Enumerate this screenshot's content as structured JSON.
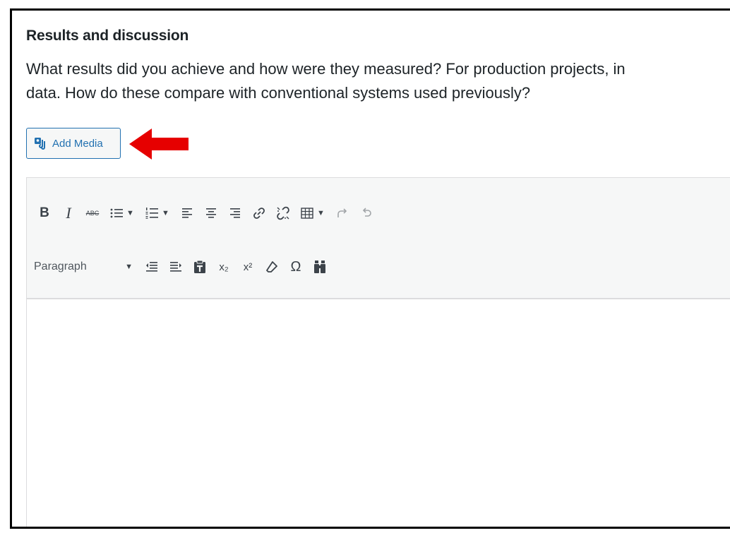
{
  "section": {
    "title": "Results and discussion",
    "desc_line1": "What results did you achieve and how were they measured? For production projects, in",
    "desc_line2": "data. How do these compare with conventional systems used previously?"
  },
  "media": {
    "add_label": "Add Media"
  },
  "toolbar": {
    "row1": [
      "bold-icon",
      "italic-icon",
      "strikethrough-icon",
      "bullet-list-icon",
      "numbered-list-icon",
      "align-left-icon",
      "align-center-icon",
      "align-right-icon",
      "link-icon",
      "unlink-icon",
      "table-icon",
      "redo-icon",
      "undo-icon"
    ],
    "bold_glyph": "B",
    "italic_glyph": "I",
    "strike_glyph": "ABC",
    "subscript_glyph": "x₂",
    "superscript_glyph": "x²",
    "omega_glyph": "Ω",
    "format_select": "Paragraph"
  },
  "colors": {
    "accent": "#2271b1",
    "arrow": "#e60000",
    "toolbar_bg": "#f6f7f7"
  }
}
